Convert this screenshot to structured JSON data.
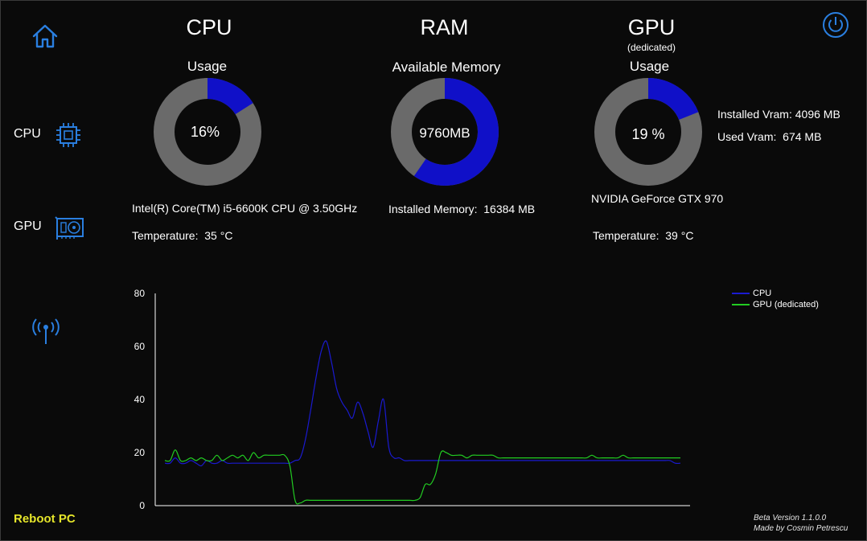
{
  "nav": {
    "home_icon": "home-icon",
    "cpu_label": "CPU",
    "cpu_icon": "chip-icon",
    "gpu_label": "GPU",
    "gpu_icon": "graphics-card-icon",
    "wireless_icon": "antenna-icon",
    "power_icon": "power-icon",
    "reboot_label": "Reboot PC"
  },
  "cpu": {
    "title": "CPU",
    "subtitle": "Usage",
    "center": "16%",
    "usage": 0.16,
    "name": "Intel(R) Core(TM) i5-6600K CPU @ 3.50GHz",
    "temp_label": "Temperature:",
    "temp_value": "35 °C"
  },
  "ram": {
    "title": "RAM",
    "subtitle": "Available Memory",
    "center": "9760MB",
    "fraction": 0.596,
    "installed_label": "Installed Memory:",
    "installed_value": "16384 MB"
  },
  "gpu": {
    "title": "GPU",
    "note": "(dedicated)",
    "subtitle": "Usage",
    "center": "19 %",
    "usage": 0.19,
    "name": "NVIDIA GeForce GTX 970",
    "temp_label": "Temperature:",
    "temp_value": "39 °C",
    "vram_installed_label": "Installed Vram:",
    "vram_installed_value": "4096  MB",
    "vram_used_label": "Used Vram:",
    "vram_used_value": "674  MB"
  },
  "colors": {
    "accent": "#1010c8",
    "ring": "#6a6a6a",
    "cpu_line": "#1a1ad0",
    "gpu_line": "#22cc22",
    "icon": "#2a7fe0",
    "reboot": "#e5e52a"
  },
  "footer": {
    "version": "Beta Version 1.1.0.0",
    "author": "Made by Cosmin Petrescu"
  },
  "chart_data": {
    "type": "line",
    "ylim": [
      0,
      80
    ],
    "yticks": [
      "0",
      "20",
      "40",
      "60",
      "80"
    ],
    "legend_position": "top-right",
    "x": [
      0,
      1,
      2,
      3,
      4,
      5,
      6,
      7,
      8,
      9,
      10,
      11,
      12,
      13,
      14,
      15,
      16,
      17,
      18,
      19,
      20,
      21,
      22,
      23,
      24,
      25,
      26,
      27,
      28,
      29,
      30,
      31,
      32,
      33,
      34,
      35,
      36,
      37,
      38,
      39,
      40,
      41,
      42,
      43,
      44,
      45,
      46,
      47,
      48,
      49,
      50,
      51,
      52,
      53,
      54,
      55,
      56,
      57,
      58,
      59,
      60,
      61,
      62,
      63,
      64,
      65,
      66,
      67,
      68,
      69,
      70,
      71,
      72,
      73,
      74,
      75,
      76,
      77,
      78,
      79,
      80,
      81,
      82,
      83,
      84,
      85,
      86,
      87,
      88,
      89,
      90,
      91,
      92,
      93,
      94,
      95,
      96,
      97,
      98,
      99
    ],
    "series": [
      {
        "name": "CPU",
        "values": [
          16,
          16,
          18,
          16,
          16,
          17,
          16,
          15,
          17,
          16,
          16,
          17,
          16,
          16,
          16,
          16,
          16,
          16,
          16,
          16,
          16,
          16,
          16,
          16,
          16,
          17,
          18,
          25,
          36,
          48,
          58,
          62,
          54,
          44,
          39,
          36,
          33,
          39,
          35,
          28,
          22,
          32,
          40,
          22,
          18,
          18,
          17,
          17,
          17,
          17,
          17,
          17,
          17,
          17,
          17,
          17,
          17,
          17,
          17,
          17,
          17,
          17,
          17,
          17,
          17,
          17,
          17,
          17,
          17,
          17,
          17,
          17,
          17,
          17,
          17,
          17,
          17,
          17,
          17,
          17,
          17,
          17,
          17,
          17,
          17,
          17,
          17,
          17,
          17,
          17,
          17,
          17,
          17,
          17,
          17,
          17,
          17,
          17,
          16,
          16
        ]
      },
      {
        "name": "GPU (dedicated)",
        "values": [
          17,
          17,
          21,
          17,
          17,
          18,
          17,
          18,
          17,
          17,
          19,
          17,
          18,
          19,
          18,
          19,
          17,
          20,
          18,
          19,
          19,
          19,
          19,
          19,
          15,
          2,
          1,
          2,
          2,
          2,
          2,
          2,
          2,
          2,
          2,
          2,
          2,
          2,
          2,
          2,
          2,
          2,
          2,
          2,
          2,
          2,
          2,
          2,
          2,
          3,
          8,
          8,
          12,
          20,
          20,
          19,
          19,
          19,
          18,
          19,
          19,
          19,
          19,
          19,
          18,
          18,
          18,
          18,
          18,
          18,
          18,
          18,
          18,
          18,
          18,
          18,
          18,
          18,
          18,
          18,
          18,
          18,
          19,
          18,
          18,
          18,
          18,
          18,
          19,
          18,
          18,
          18,
          18,
          18,
          18,
          18,
          18,
          18,
          18,
          18
        ]
      }
    ]
  }
}
